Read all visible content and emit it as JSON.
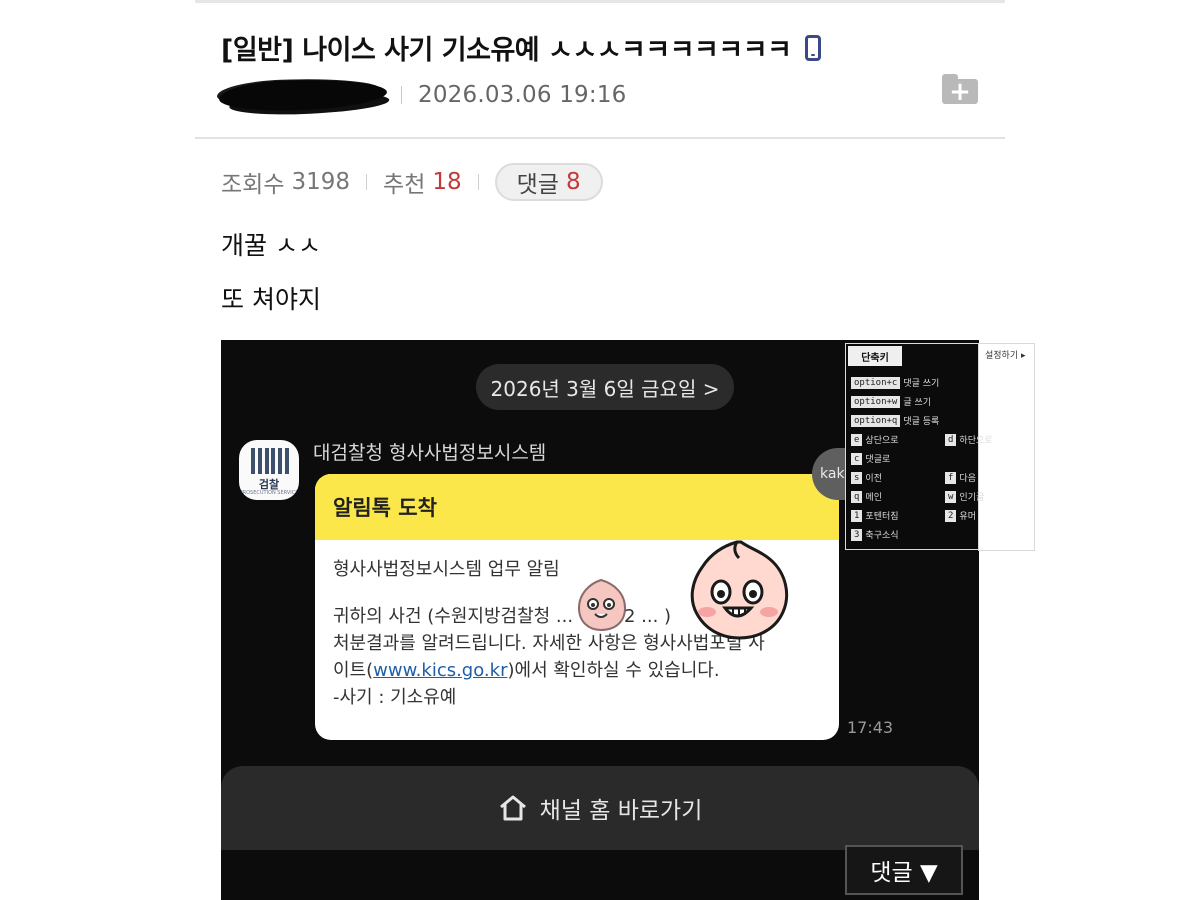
{
  "post": {
    "title": "[일반] 나이스 사기 기소유예 ㅅㅅㅅㅋㅋㅋㅋㅋㅋㅋ",
    "date": "2026.03.06 19:16",
    "views_label": "조회수",
    "views": "3198",
    "recommend_label": "추천",
    "recommend": "18",
    "comments_label": "댓글",
    "comments": "8",
    "line1": "개꿀 ㅅㅅ",
    "line2": "또 쳐야지"
  },
  "screenshot": {
    "date_pill": "2026년 3월 6일 금요일 >",
    "avatar_label": "검찰",
    "avatar_sub": "PROSECUTION SERVICE",
    "sender": "대검찰청 형사사법정보시스템",
    "card_title": "알림톡 도착",
    "card_line1": "형사사법정보시스템 업무 알림",
    "card_line2": "귀하의 사건 (수원지방검찰청 ... 청 202 ... )",
    "card_line3": "처분결과를 알려드립니다. 자세한 사항은 형사사법포털 사",
    "card_line4_pre": "이트(",
    "card_link": "www.kics.go.kr",
    "card_line4_post": ")에서 확인하실 수 있습니다.",
    "card_line5": "-사기 : 기소유예",
    "time": "17:43",
    "kaka_label": "kaka",
    "channel_button": "채널 홈 바로가기"
  },
  "comment_float": "댓글 ▼",
  "shortcuts": {
    "title": "단축키",
    "settings": "설정하기",
    "items": [
      {
        "key": "option+c",
        "label": "댓글 쓰기"
      },
      {
        "key": "option+w",
        "label": "글 쓰기"
      },
      {
        "key": "option+q",
        "label": "댓글 등록"
      },
      {
        "key": "e",
        "label": "상단으로"
      },
      {
        "key": "d",
        "label": "하단으로"
      },
      {
        "key": "c",
        "label": "댓글로"
      },
      {
        "key": "s",
        "label": "이전"
      },
      {
        "key": "f",
        "label": "다음"
      },
      {
        "key": "q",
        "label": "메인"
      },
      {
        "key": "w",
        "label": "인기글"
      },
      {
        "key": "1",
        "label": "포텐터짐"
      },
      {
        "key": "2",
        "label": "유머"
      },
      {
        "key": "3",
        "label": "축구소식"
      }
    ]
  },
  "colors": {
    "accent_red": "#c23b3b",
    "kakao_yellow": "#fbe74a",
    "link_blue": "#1f5fa8"
  }
}
